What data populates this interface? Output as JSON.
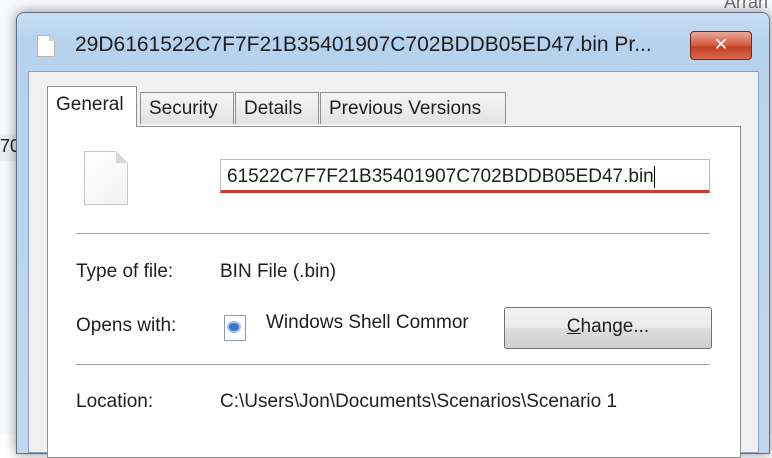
{
  "background": {
    "top_right_text": "Arran",
    "left_text": "70"
  },
  "dialog": {
    "title": "29D6161522C7F7F21B35401907C702BDDB05ED47.bin Pr...",
    "close_label": "✕"
  },
  "tabs": [
    {
      "label": "General",
      "active": true
    },
    {
      "label": "Security",
      "active": false
    },
    {
      "label": "Details",
      "active": false
    },
    {
      "label": "Previous Versions",
      "active": false
    }
  ],
  "general": {
    "file_name_value": "61522C7F7F21B35401907C702BDDB05ED47.bin",
    "type_label": "Type of file:",
    "type_value": "BIN File (.bin)",
    "opens_label": "Opens with:",
    "opens_value": "Windows Shell Commor",
    "change_button_underlined": "C",
    "change_button_rest": "hange...",
    "location_label": "Location:",
    "location_value": "C:\\Users\\Jon\\Documents\\Scenarios\\Scenario 1"
  },
  "colors": {
    "input_underline": "#d13b27",
    "close_button": "#c3401f"
  }
}
